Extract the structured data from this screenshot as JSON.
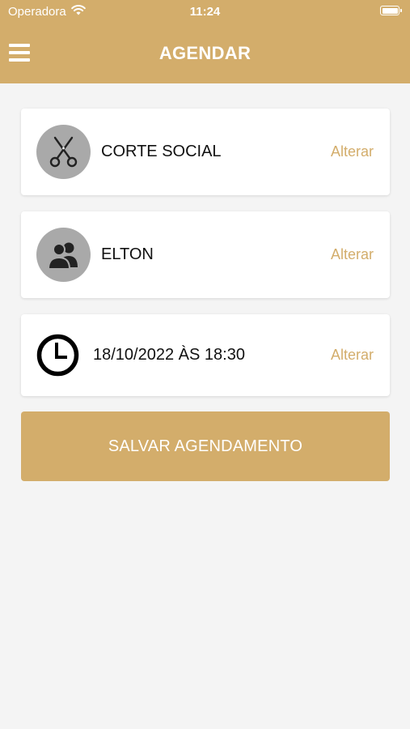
{
  "status_bar": {
    "carrier": "Operadora",
    "time": "11:24",
    "wifi_icon": "wifi-icon",
    "battery_icon": "battery-icon"
  },
  "header": {
    "title": "AGENDAR",
    "menu_icon": "hamburger-menu-icon"
  },
  "booking": {
    "service": {
      "label": "CORTE SOCIAL",
      "action": "Alterar",
      "icon": "scissors-icon"
    },
    "professional": {
      "label": "ELTON",
      "action": "Alterar",
      "icon": "users-icon"
    },
    "datetime": {
      "label": "18/10/2022 ÀS 18:30",
      "action": "Alterar",
      "icon": "clock-icon"
    }
  },
  "save_button_label": "SALVAR AGENDAMENTO",
  "colors": {
    "accent": "#d3ad6b",
    "background": "#f4f4f4",
    "avatar_bg": "#a9a9a9"
  }
}
